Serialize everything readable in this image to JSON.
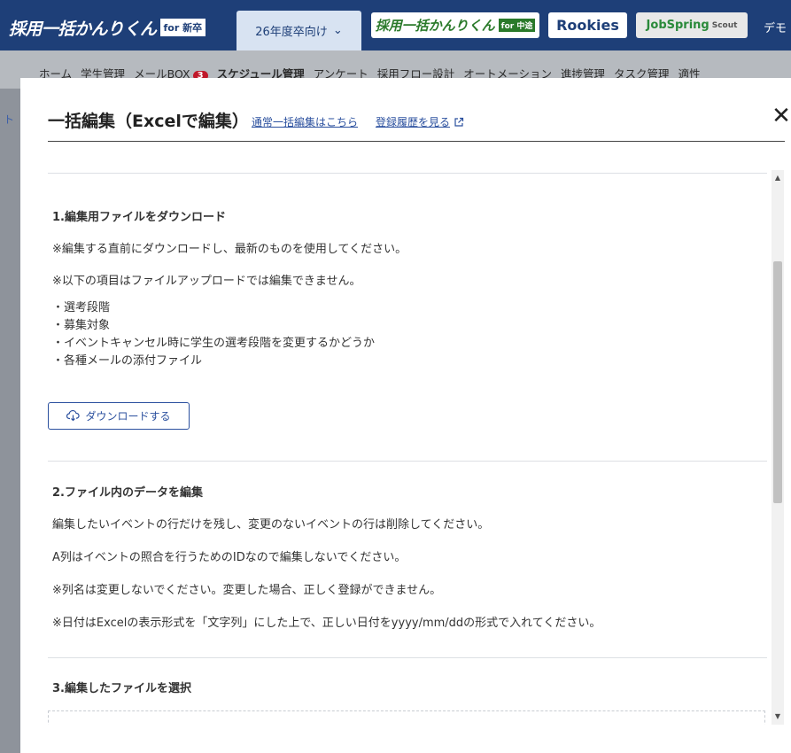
{
  "header": {
    "brand_text": "採用一括かんりくん",
    "brand_badge": "for 新卒",
    "year_tab": "26年度卒向け",
    "year_tab_icon": "chevron-down-icon",
    "chip_mid_text": "採用一括かんりくん",
    "chip_mid_tag": "for 中途",
    "chip_rookies": "Rookies",
    "chip_job": "JobSpring",
    "chip_job_sub": "Scout",
    "demo": "デモ"
  },
  "nav": {
    "items": [
      "ホーム",
      "学生管理",
      "メールBOX",
      "スケジュール管理",
      "アンケート",
      "採用フロー設計",
      "オートメーション",
      "進捗管理",
      "タスク管理",
      "適性"
    ],
    "mail_badge": "3"
  },
  "underlay": {
    "crumb": "ト"
  },
  "modal": {
    "title": "一括編集（Excelで編集）",
    "link_normal_edit": "通常一括編集はこちら",
    "link_history": "登録履歴を見る",
    "close_icon": "close-icon",
    "sections": [
      {
        "title": "1.編集用ファイルをダウンロード",
        "lines": [
          "※編集する直前にダウンロードし、最新のものを使用してください。",
          "※以下の項目はファイルアップロードでは編集できません。"
        ],
        "bullets": [
          "・選考段階",
          "・募集対象",
          "・イベントキャンセル時に学生の選考段階を変更するかどうか",
          "・各種メールの添付ファイル"
        ],
        "button": "ダウンロードする"
      },
      {
        "title": "2.ファイル内のデータを編集",
        "lines": [
          "編集したいイベントの行だけを残し、変更のないイベントの行は削除してください。",
          "A列はイベントの照合を行うためのIDなので編集しないでください。",
          "※列名は変更しないでください。変更した場合、正しく登録ができません。",
          "※日付はExcelの表示形式を「文字列」にした上で、正しい日付をyyyy/mm/ddの形式で入れてください。"
        ]
      },
      {
        "title": "3.編集したファイルを選択"
      }
    ]
  }
}
